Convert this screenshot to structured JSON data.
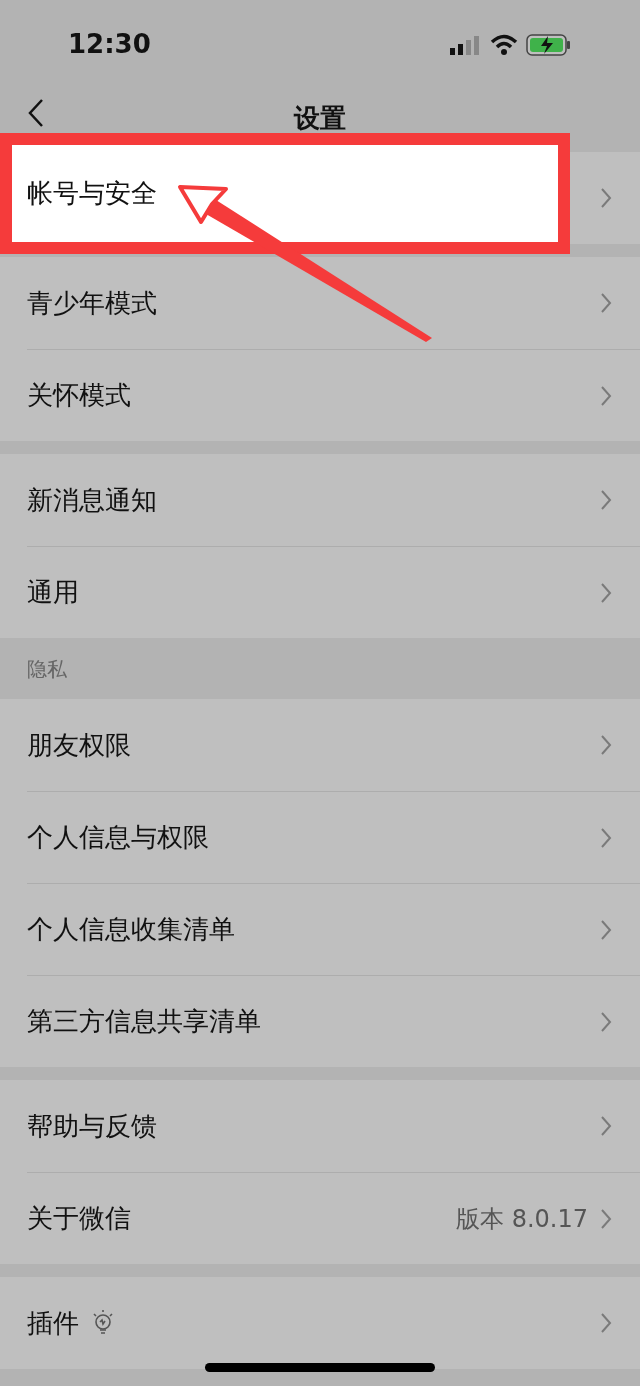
{
  "status_bar": {
    "time": "12:30"
  },
  "nav": {
    "title": "设置"
  },
  "groups": [
    {
      "items": [
        {
          "label": "帐号与安全",
          "kind": "link",
          "highlighted": true
        }
      ]
    },
    {
      "items": [
        {
          "label": "青少年模式",
          "kind": "link",
          "highlighted": false
        },
        {
          "label": "关怀模式",
          "kind": "link",
          "highlighted": false
        }
      ]
    },
    {
      "items": [
        {
          "label": "新消息通知",
          "kind": "link",
          "highlighted": false
        },
        {
          "label": "通用",
          "kind": "link",
          "highlighted": false
        }
      ]
    },
    {
      "header": "隐私",
      "items": [
        {
          "label": "朋友权限",
          "kind": "link",
          "highlighted": false
        },
        {
          "label": "个人信息与权限",
          "kind": "link",
          "highlighted": false
        },
        {
          "label": "个人信息收集清单",
          "kind": "link",
          "highlighted": false
        },
        {
          "label": "第三方信息共享清单",
          "kind": "link",
          "highlighted": false
        }
      ]
    },
    {
      "items": [
        {
          "label": "帮助与反馈",
          "kind": "link",
          "highlighted": false
        },
        {
          "label": "关于微信",
          "value": "版本 8.0.17",
          "kind": "link",
          "highlighted": false
        }
      ]
    },
    {
      "items": [
        {
          "label": "插件",
          "kind": "link_bulb",
          "highlighted": false
        }
      ]
    }
  ]
}
